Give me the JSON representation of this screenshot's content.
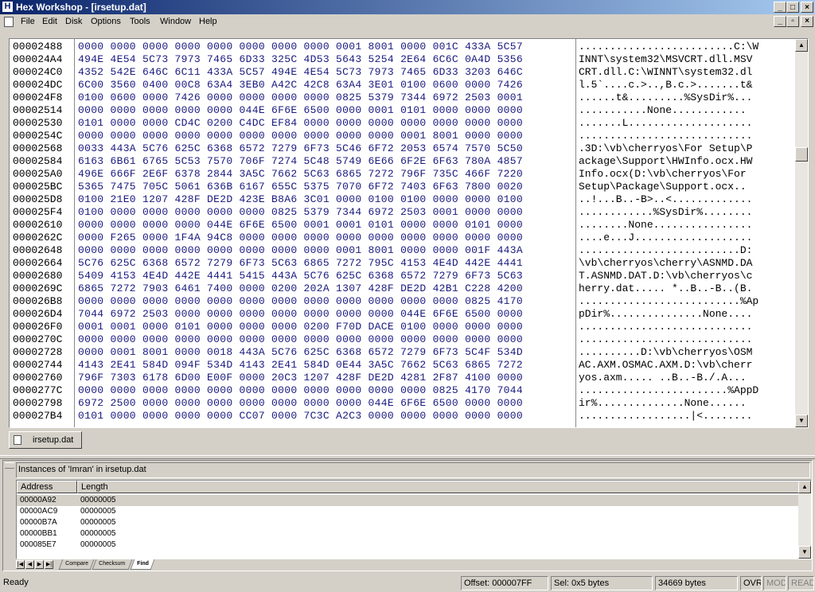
{
  "window": {
    "title": "Hex Workshop - [irsetup.dat]",
    "app_icon": "H"
  },
  "menu": [
    "File",
    "Edit",
    "Disk",
    "Options",
    "Tools",
    "Window",
    "Help"
  ],
  "hex_rows": [
    {
      "addr": "00002488",
      "hex": "0000 0000 0000 0000 0000 0000 0000 0000 0001 8001 0000 001C 433A 5C57",
      "ascii": ".........................C:\\W"
    },
    {
      "addr": "000024A4",
      "hex": "494E 4E54 5C73 7973 7465 6D33 325C 4D53 5643 5254 2E64 6C6C 0A4D 5356",
      "ascii": "INNT\\system32\\MSVCRT.dll.MSV"
    },
    {
      "addr": "000024C0",
      "hex": "4352 542E 646C 6C11 433A 5C57 494E 4E54 5C73 7973 7465 6D33 3203 646C",
      "ascii": "CRT.dll.C:\\WINNT\\system32.dl"
    },
    {
      "addr": "000024DC",
      "hex": "6C00 3560 0400 00C8 63A4 3EB0 A42C 42C8 63A4 3E01 0100 0600 0000 7426",
      "ascii": "l.5`....c.>..,B.c.>.......t&"
    },
    {
      "addr": "000024F8",
      "hex": "0100 0600 0000 7426 0000 0000 0000 0000 0825 5379 7344 6972 2503 0001",
      "ascii": "......t&.........%SysDir%..."
    },
    {
      "addr": "00002514",
      "hex": "0000 0000 0000 0000 0000 044E 6F6E 6500 0000 0001 0101 0000 0000 0000",
      "ascii": "...........None............"
    },
    {
      "addr": "00002530",
      "hex": "0101 0000 0000 CD4C 0200 C4DC EF84 0000 0000 0000 0000 0000 0000 0000",
      "ascii": ".......L...................."
    },
    {
      "addr": "0000254C",
      "hex": "0000 0000 0000 0000 0000 0000 0000 0000 0000 0000 0001 8001 0000 0000",
      "ascii": "............................"
    },
    {
      "addr": "00002568",
      "hex": "0033 443A 5C76 625C 6368 6572 7279 6F73 5C46 6F72 2053 6574 7570 5C50",
      "ascii": ".3D:\\vb\\cherryos\\For Setup\\P"
    },
    {
      "addr": "00002584",
      "hex": "6163 6B61 6765 5C53 7570 706F 7274 5C48 5749 6E66 6F2E 6F63 780A 4857",
      "ascii": "ackage\\Support\\HWInfo.ocx.HW"
    },
    {
      "addr": "000025A0",
      "hex": "496E 666F 2E6F 6378 2844 3A5C 7662 5C63 6865 7272 796F 735C 466F 7220",
      "ascii": "Info.ocx(D:\\vb\\cherryos\\For "
    },
    {
      "addr": "000025BC",
      "hex": "5365 7475 705C 5061 636B 6167 655C 5375 7070 6F72 7403 6F63 7800 0020",
      "ascii": "Setup\\Package\\Support.ocx.. "
    },
    {
      "addr": "000025D8",
      "hex": "0100 21E0 1207 428F DE2D 423E B8A6 3C01 0000 0100 0100 0000 0000 0100",
      "ascii": "..!...B..-B>..<............."
    },
    {
      "addr": "000025F4",
      "hex": "0100 0000 0000 0000 0000 0000 0825 5379 7344 6972 2503 0001 0000 0000",
      "ascii": "............%SysDir%........"
    },
    {
      "addr": "00002610",
      "hex": "0000 0000 0000 0000 044E 6F6E 6500 0001 0001 0101 0000 0000 0101 0000",
      "ascii": "........None................"
    },
    {
      "addr": "0000262C",
      "hex": "0000 F265 0000 1F4A 94C8 0000 0000 0000 0000 0000 0000 0000 0000 0000",
      "ascii": "....e...J..................."
    },
    {
      "addr": "00002648",
      "hex": "0000 0000 0000 0000 0000 0000 0000 0000 0001 8001 0000 0000 001F 443A",
      "ascii": "..........................D:"
    },
    {
      "addr": "00002664",
      "hex": "5C76 625C 6368 6572 7279 6F73 5C63 6865 7272 795C 4153 4E4D 442E 4441",
      "ascii": "\\vb\\cherryos\\cherry\\ASNMD.DA"
    },
    {
      "addr": "00002680",
      "hex": "5409 4153 4E4D 442E 4441 5415 443A 5C76 625C 6368 6572 7279 6F73 5C63",
      "ascii": "T.ASNMD.DAT.D:\\vb\\cherryos\\c"
    },
    {
      "addr": "0000269C",
      "hex": "6865 7272 7903 6461 7400 0000 0200 202A 1307 428F DE2D 42B1 C228 4200",
      "ascii": "herry.dat..... *..B..-B..(B."
    },
    {
      "addr": "000026B8",
      "hex": "0000 0000 0000 0000 0000 0000 0000 0000 0000 0000 0000 0000 0825 4170",
      "ascii": "..........................%Ap"
    },
    {
      "addr": "000026D4",
      "hex": "7044 6972 2503 0000 0000 0000 0000 0000 0000 0000 044E 6F6E 6500 0000",
      "ascii": "pDir%...............None...."
    },
    {
      "addr": "000026F0",
      "hex": "0001 0001 0000 0101 0000 0000 0000 0200 F70D DACE 0100 0000 0000 0000",
      "ascii": "............................"
    },
    {
      "addr": "0000270C",
      "hex": "0000 0000 0000 0000 0000 0000 0000 0000 0000 0000 0000 0000 0000 0000",
      "ascii": "............................"
    },
    {
      "addr": "00002728",
      "hex": "0000 0001 8001 0000 0018 443A 5C76 625C 6368 6572 7279 6F73 5C4F 534D",
      "ascii": "..........D:\\vb\\cherryos\\OSM"
    },
    {
      "addr": "00002744",
      "hex": "4143 2E41 584D 094F 534D 4143 2E41 584D 0E44 3A5C 7662 5C63 6865 7272",
      "ascii": "AC.AXM.OSMAC.AXM.D:\\vb\\cherr"
    },
    {
      "addr": "00002760",
      "hex": "796F 7303 6178 6D00 E00F 0000 20C3 1207 428F DE2D 4281 2F87 4100 0000",
      "ascii": "yos.axm..... ..B..-B./.A..."
    },
    {
      "addr": "0000277C",
      "hex": "0000 0000 0000 0000 0000 0000 0000 0000 0000 0000 0000 0825 4170 7044",
      "ascii": "........................%AppD"
    },
    {
      "addr": "00002798",
      "hex": "6972 2500 0000 0000 0000 0000 0000 0000 0000 044E 6F6E 6500 0000 0000",
      "ascii": "ir%..............None......"
    },
    {
      "addr": "000027B4",
      "hex": "0101 0000 0000 0000 0000 CC07 0000 7C3C A2C3 0000 0000 0000 0000 0000",
      "ascii": "..................|<........"
    }
  ],
  "doc_tab": {
    "label": "irsetup.dat"
  },
  "find_panel": {
    "title": "Instances of 'Imran' in irsetup.dat",
    "columns": [
      "Address",
      "Length"
    ],
    "rows": [
      {
        "address": "00000A92",
        "length": "00000005"
      },
      {
        "address": "00000AC9",
        "length": "00000005"
      },
      {
        "address": "00000B7A",
        "length": "00000005"
      },
      {
        "address": "00000BB1",
        "length": "00000005"
      },
      {
        "address": "000085E7",
        "length": "00000005"
      }
    ],
    "tabs": [
      "Compare",
      "Checksum",
      "Find"
    ],
    "active_tab": "Find"
  },
  "status": {
    "ready": "Ready",
    "offset": "Offset: 000007FF",
    "sel": "Sel: 0x5 bytes",
    "size": "34669 bytes",
    "ovr": "OVR",
    "mod": "MOD",
    "read": "READ"
  },
  "colors": {
    "title_start": "#0a246a",
    "title_end": "#a6caf0",
    "hex_text": "#1a1a80",
    "face": "#d4d0c8"
  }
}
